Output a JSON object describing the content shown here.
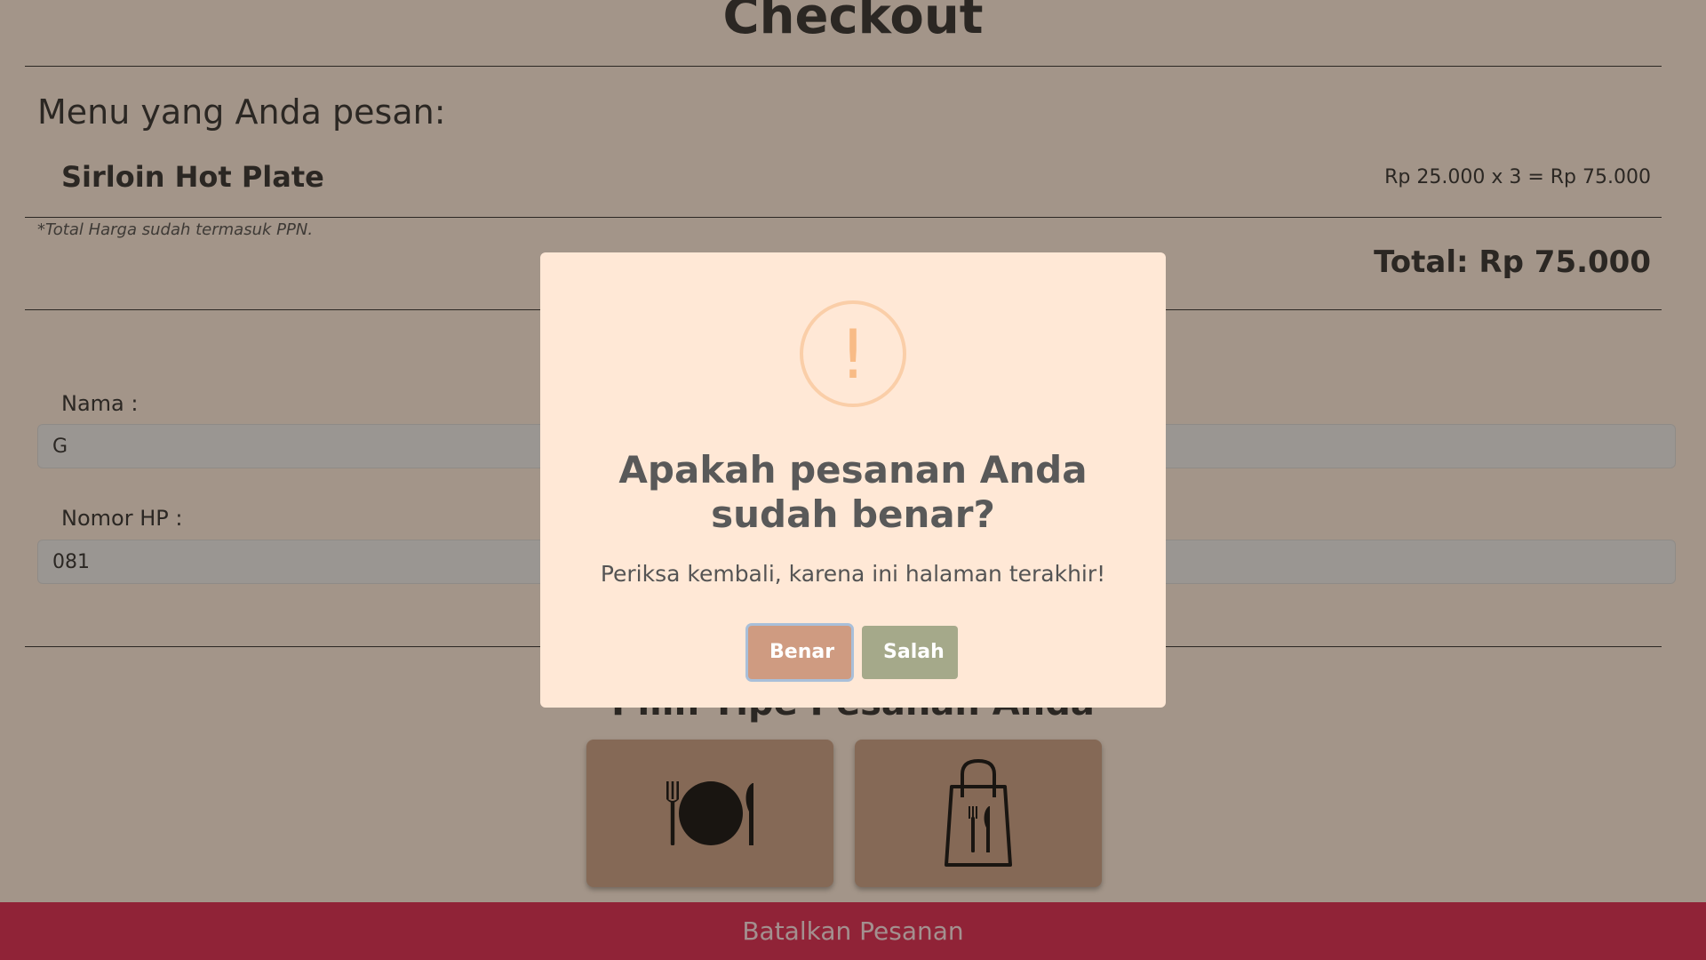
{
  "page": {
    "title": "Checkout",
    "menu_heading": "Menu yang Anda pesan:",
    "order": {
      "item_name": "Sirloin Hot Plate",
      "item_price_line": "Rp 25.000 x 3 = Rp 75.000"
    },
    "ppn_note": "*Total Harga sudah termasuk PPN.",
    "total": "Total: Rp 75.000",
    "form": {
      "name_label": "Nama :",
      "name_value": "G",
      "phone_label": "Nomor HP :",
      "phone_value": "081"
    },
    "order_type_heading": "Pilih Tipe Pesanan Anda",
    "order_types": [
      {
        "icon": "dine-in-icon"
      },
      {
        "icon": "takeaway-bag-icon"
      }
    ],
    "cancel_label": "Batalkan Pesanan"
  },
  "dialog": {
    "icon": "warning-icon",
    "icon_glyph": "!",
    "title": "Apakah pesanan Anda sudah benar?",
    "text": "Periksa kembali, karena ini halaman terakhir!",
    "confirm_label": "Benar",
    "cancel_label": "Salah"
  },
  "colors": {
    "page_bg": "#fbe9da",
    "card_bg": "#c59a7e",
    "cancel_bar": "#d91a45",
    "dialog_bg": "#ffe8d6",
    "confirm_btn": "#cf9b81",
    "cancel_btn": "#a5a98a",
    "warning": "#f8bb86"
  }
}
